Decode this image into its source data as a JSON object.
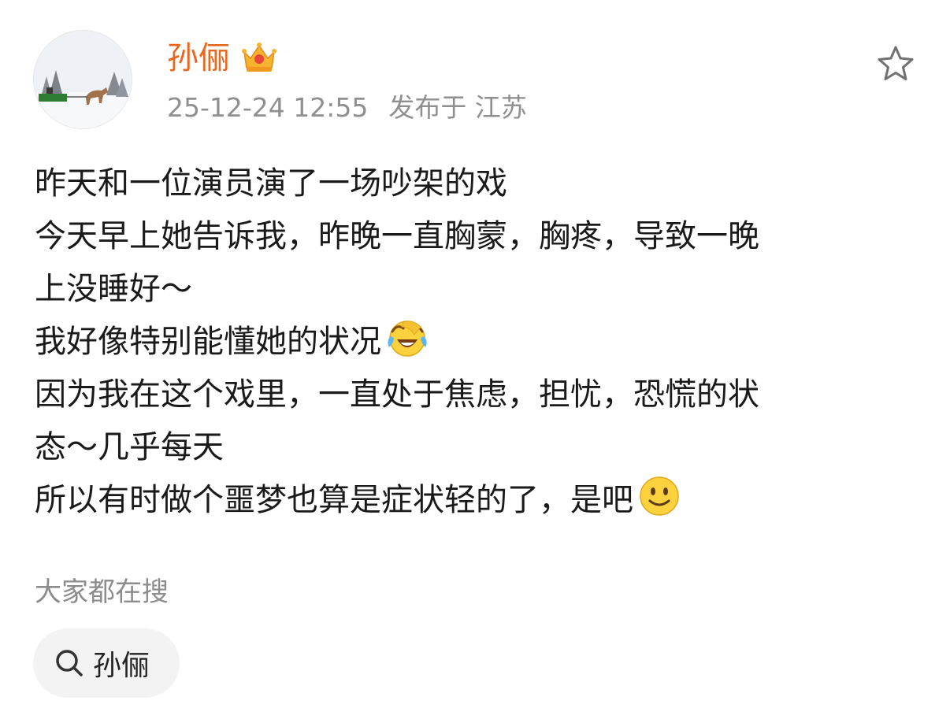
{
  "header": {
    "username": "孙俪",
    "timestamp": "25-12-24 12:55",
    "location": "发布于 江苏",
    "icons": {
      "avatar": "snow-scene-avatar",
      "badge": "crown-icon",
      "favorite": "star-icon"
    },
    "colors": {
      "username": "#e8671d",
      "meta": "#8f8f8f"
    }
  },
  "post": {
    "lines": [
      "昨天和一位演员演了一场吵架的戏",
      "今天早上她告诉我，昨晚一直胸蒙，胸疼，导致一晚",
      "上没睡好～",
      "我好像特别能懂她的状况",
      "因为我在这个戏里，一直处于焦虑，担忧，恐慌的状",
      "态～几乎每天",
      "所以有时做个噩梦也算是症状轻的了，是吧"
    ],
    "emojis": {
      "line4": "laughing-crying-emoji",
      "line7": "smiling-face-emoji"
    }
  },
  "search": {
    "title": "大家都在搜",
    "chip_label": "孙俪",
    "chip_icon": "search-icon"
  }
}
